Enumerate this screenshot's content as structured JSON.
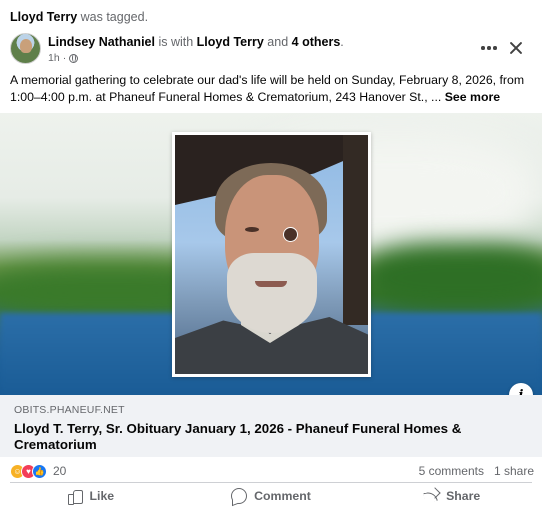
{
  "tag_header": {
    "name": "Lloyd Terry",
    "suffix": " was tagged."
  },
  "post": {
    "author": "Lindsey Nathaniel",
    "with_text": " is with ",
    "tagged": "Lloyd Terry",
    "and_text": " and ",
    "others": "4 others",
    "period": ".",
    "time": "1h",
    "audience_icon": "globe-icon",
    "text": "A memorial gathering to celebrate our dad's life will be held on Sunday, February 8, 2026, from 1:00–4:00 p.m. at Phaneuf Funeral Homes & Crematorium, 243 Hanover St., ... ",
    "see_more": "See more"
  },
  "link_preview": {
    "domain": "OBITS.PHANEUF.NET",
    "title": "Lloyd T. Terry, Sr. Obituary January 1, 2026 - Phaneuf Funeral Homes & Crematorium",
    "info_icon_label": "i"
  },
  "engagement": {
    "reaction_icons": [
      "care-icon",
      "love-icon",
      "like-icon"
    ],
    "reaction_count": "20",
    "comments": "5 comments",
    "shares": "1 share"
  },
  "actions": {
    "like": "Like",
    "comment": "Comment",
    "share": "Share"
  },
  "colors": {
    "text": "#050505",
    "secondary": "#65676b",
    "link_bg": "#f0f2f5",
    "like": "#1877f2",
    "love": "#f33e58",
    "care": "#f7b125"
  }
}
